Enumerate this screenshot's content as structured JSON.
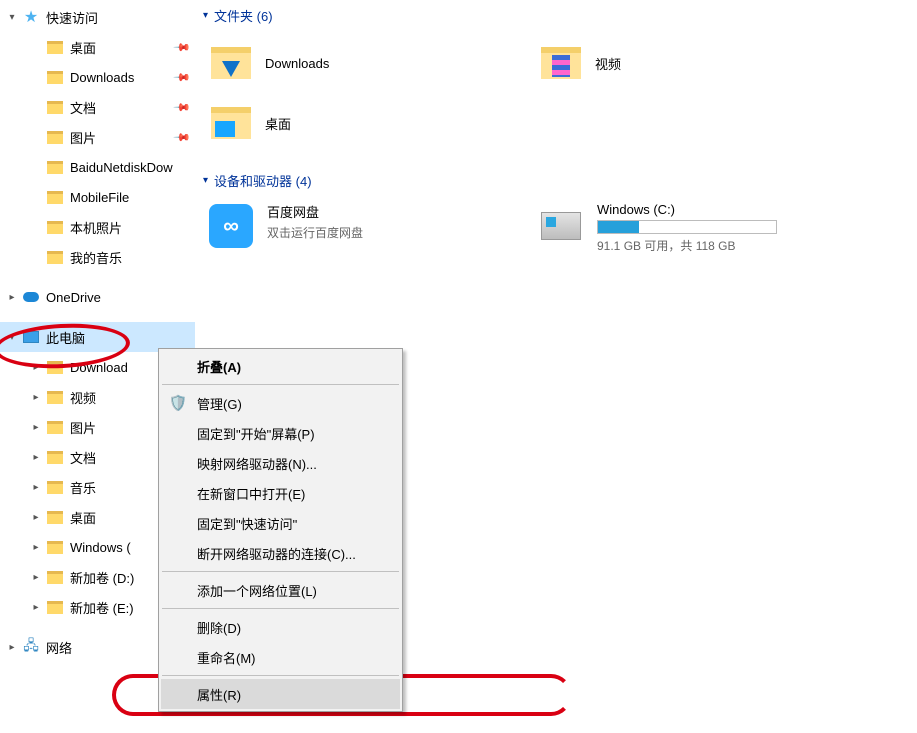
{
  "sidebar": {
    "quickAccess": {
      "label": "快速访问",
      "items": [
        {
          "label": "桌面",
          "pinned": true
        },
        {
          "label": "Downloads",
          "pinned": true
        },
        {
          "label": "文档",
          "pinned": true
        },
        {
          "label": "图片",
          "pinned": true
        },
        {
          "label": "BaiduNetdiskDow",
          "pinned": false
        },
        {
          "label": "MobileFile",
          "pinned": false
        },
        {
          "label": "本机照片",
          "pinned": false
        },
        {
          "label": "我的音乐",
          "pinned": false
        }
      ]
    },
    "oneDrive": {
      "label": "OneDrive"
    },
    "thisPc": {
      "label": "此电脑",
      "items": [
        {
          "label": "Download"
        },
        {
          "label": "视频"
        },
        {
          "label": "图片"
        },
        {
          "label": "文档"
        },
        {
          "label": "音乐"
        },
        {
          "label": "桌面"
        },
        {
          "label": "Windows ("
        },
        {
          "label": "新加卷 (D:)"
        },
        {
          "label": "新加卷 (E:)"
        }
      ]
    },
    "network": {
      "label": "网络"
    }
  },
  "main": {
    "folderGroup": {
      "header": "文件夹 (6)",
      "items": [
        {
          "label": "Downloads",
          "icon": "download"
        },
        {
          "label": "视频",
          "icon": "video"
        },
        {
          "label": "桌面",
          "icon": "desktop"
        }
      ]
    },
    "driveGroup": {
      "header": "设备和驱动器 (4)",
      "items": [
        {
          "title": "百度网盘",
          "sub": "双击运行百度网盘",
          "icon": "baidu"
        },
        {
          "title": "Windows (C:)",
          "sub": "91.1 GB 可用，共 118 GB",
          "icon": "drive",
          "progress": 23
        }
      ]
    }
  },
  "contextMenu": {
    "items": [
      {
        "label": "折叠(A)",
        "bold": true
      },
      {
        "sep": true
      },
      {
        "label": "管理(G)",
        "icon": "shield"
      },
      {
        "label": "固定到\"开始\"屏幕(P)"
      },
      {
        "label": "映射网络驱动器(N)..."
      },
      {
        "label": "在新窗口中打开(E)"
      },
      {
        "label": "固定到\"快速访问\""
      },
      {
        "label": "断开网络驱动器的连接(C)..."
      },
      {
        "sep": true
      },
      {
        "label": "添加一个网络位置(L)"
      },
      {
        "sep": true
      },
      {
        "label": "删除(D)"
      },
      {
        "label": "重命名(M)"
      },
      {
        "sep": true
      },
      {
        "label": "属性(R)",
        "highlight": true
      }
    ]
  }
}
